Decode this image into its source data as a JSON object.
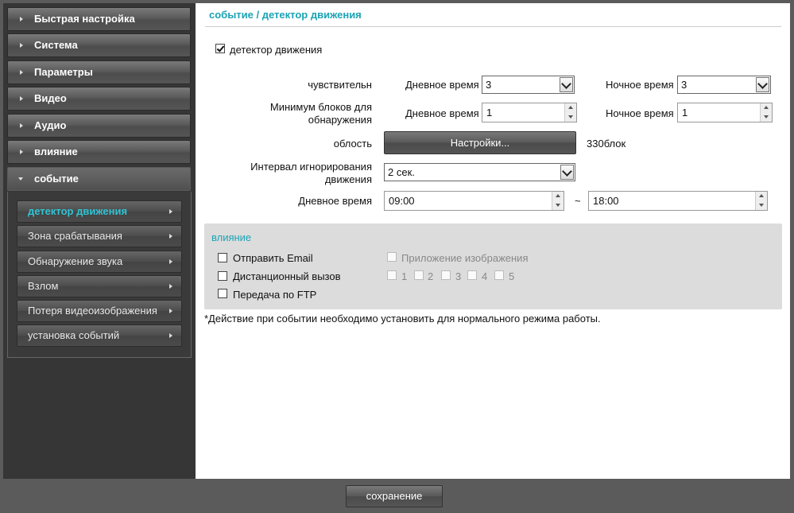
{
  "sidebar": {
    "menu": [
      {
        "label": "Быстрая настройка"
      },
      {
        "label": "Система"
      },
      {
        "label": "Параметры"
      },
      {
        "label": "Видео"
      },
      {
        "label": "Аудио"
      },
      {
        "label": "влияние"
      },
      {
        "label": "событие"
      }
    ],
    "submenu": [
      {
        "label": "детектор движения"
      },
      {
        "label": "Зона срабатывания"
      },
      {
        "label": "Обнаружение звука"
      },
      {
        "label": "Взлом"
      },
      {
        "label": "Потеря видеоизображения"
      },
      {
        "label": "установка событий"
      }
    ]
  },
  "content": {
    "title": "событие / детектор движения",
    "motion_detector": {
      "label": "детектор движения",
      "checked": true
    },
    "sensitivity": {
      "label": "чувствительн",
      "day_label": "Дневное время",
      "day_value": "3",
      "night_label": "Ночное время",
      "night_value": "3"
    },
    "min_blocks": {
      "label": "Минимум блоков для обнаружения",
      "day_label": "Дневное время",
      "day_value": "1",
      "night_label": "Ночное время",
      "night_value": "1"
    },
    "area": {
      "label": "облость",
      "button": "Настройки...",
      "blocks": "330блок"
    },
    "ignore_interval": {
      "label": "Интервал игнорирования движения",
      "value": "2 сек."
    },
    "daytime": {
      "label": "Дневное время",
      "start": "09:00",
      "separator": "~",
      "end": "18:00"
    },
    "action": {
      "title": "влияние",
      "send_email": "Отправить Email",
      "remote_call": "Дистанционный вызов",
      "ftp": "Передача по FTP",
      "attach_image": "Приложение изображения",
      "channels": [
        "1",
        "2",
        "3",
        "4",
        "5"
      ]
    },
    "footnote": "*Действие при событии необходимо установить для нормального режима работы."
  },
  "footer": {
    "save": "сохранение"
  },
  "colors": {
    "accent": "#1ba3b5",
    "active_sub": "#31c3d4",
    "background": "#5b5b5b"
  }
}
